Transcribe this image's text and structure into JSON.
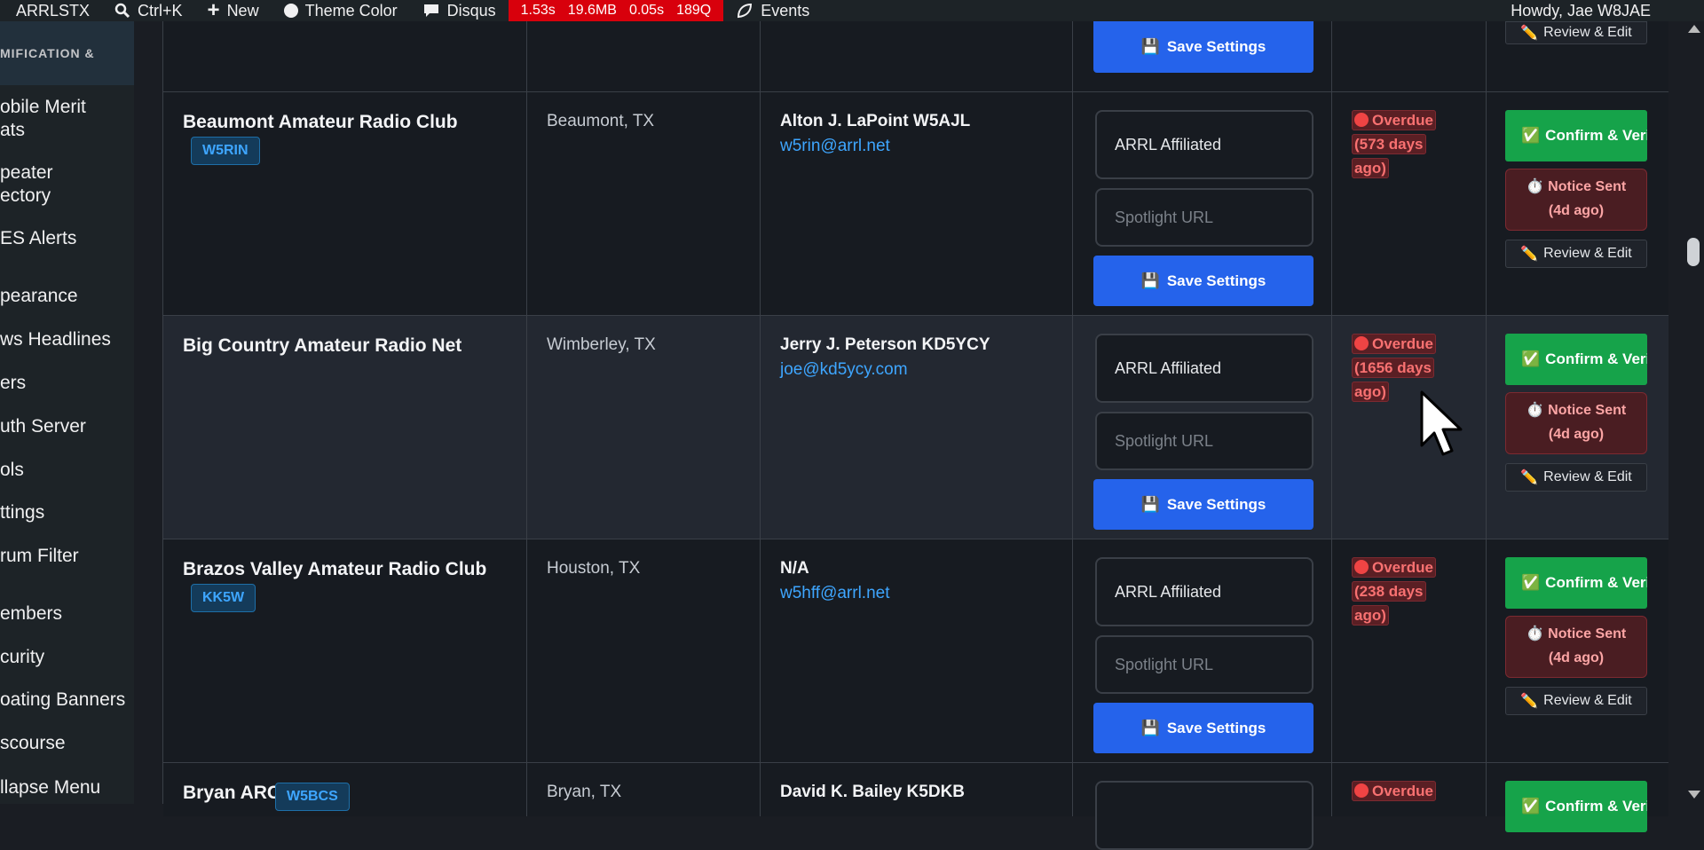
{
  "adminbar": {
    "site": "ARRLSTX",
    "search": "Ctrl+K",
    "new": "New",
    "theme": "Theme Color",
    "disqus": "Disqus",
    "perf": [
      "1.53s",
      "19.6MB",
      "0.05s",
      "189Q"
    ],
    "events": "Events",
    "howdy": "Howdy, Jae W8JAE"
  },
  "sidebar": {
    "group": "MIFICATION &",
    "items": [
      "obile Merit",
      "ats",
      "peater",
      "ectory",
      "ES Alerts",
      "pearance",
      "ws Headlines",
      "ers",
      "uth Server",
      "ols",
      "ttings",
      "rum Filter",
      "embers",
      "curity",
      "oating Banners",
      "scourse",
      "llapse Menu"
    ]
  },
  "labels": {
    "save": "Save Settings",
    "affiliated": "ARRL Affiliated",
    "spotlight_placeholder": "Spotlight URL",
    "confirm": "Confirm & Verify",
    "notice_line1": "Notice Sent",
    "notice_line2": "(4d ago)",
    "review": "Review & Edit",
    "overdue": "Overdue"
  },
  "rows": [
    {
      "name": "Beaumont Amateur Radio Club",
      "callsign": "W5RIN",
      "location": "Beaumont, TX",
      "contact": "Alton J. LaPoint W5AJL",
      "email": "w5rin@arrl.net",
      "overdue_detail": "(573 days ago)"
    },
    {
      "name": "Big Country Amateur Radio Net",
      "callsign": "",
      "location": "Wimberley, TX",
      "contact": "Jerry J. Peterson KD5YCY",
      "email": "joe@kd5ycy.com",
      "overdue_detail": "(1656 days ago)"
    },
    {
      "name": "Brazos Valley Amateur Radio Club",
      "callsign": "KK5W",
      "location": "Houston, TX",
      "contact": "N/A",
      "email": "w5hff@arrl.net",
      "overdue_detail": "(238 days ago)"
    },
    {
      "name": "Bryan ARC",
      "callsign": "W5BCS",
      "location": "Bryan, TX",
      "contact": "David K. Bailey K5DKB",
      "email": "",
      "overdue_detail": ""
    }
  ]
}
